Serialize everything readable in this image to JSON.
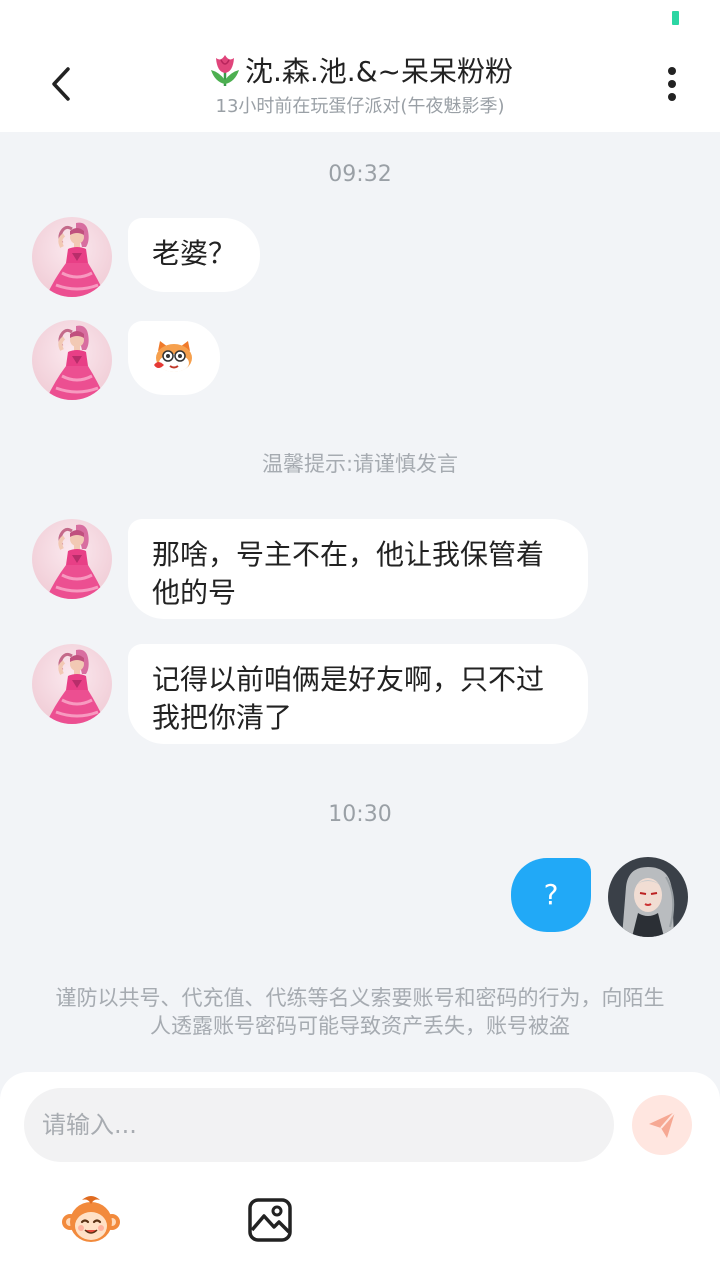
{
  "header": {
    "title": "沈.森.池.&~呆呆粉粉",
    "subtitle": "13小时前在玩蛋仔派对(午夜魅影季)",
    "back_icon": "chevron-left-icon",
    "more_icon": "more-vertical-icon",
    "title_icon": "tulip-icon"
  },
  "chat": {
    "timestamp_1": "09:32",
    "notice": "温馨提示:请谨慎发言",
    "timestamp_2": "10:30",
    "messages": [
      {
        "from": "contact",
        "text": "老婆？"
      },
      {
        "from": "contact",
        "type": "sticker",
        "icon": "blushing-cat-sticker-icon"
      },
      {
        "from": "contact",
        "text": "那啥，号主不在，他让我保管着他的号"
      },
      {
        "from": "contact",
        "text": "记得以前咱俩是好友啊，只不过我把你清了"
      },
      {
        "from": "me",
        "text": "?"
      }
    ],
    "warning": "谨防以共号、代充值、代练等名义索要账号和密码的行为，向陌生人透露账号密码可能导致资产丢失，账号被盗"
  },
  "input": {
    "placeholder": "请输入..."
  },
  "toolbar": {
    "send_icon": "paper-plane-icon",
    "emoji_icon": "monkey-emoji-icon",
    "image_icon": "image-icon"
  },
  "colors": {
    "my_bubble": "#21a9f7",
    "background": "#f2f4f7",
    "send_button": "#ffe6e0",
    "status_battery": "#2bd6a3"
  }
}
